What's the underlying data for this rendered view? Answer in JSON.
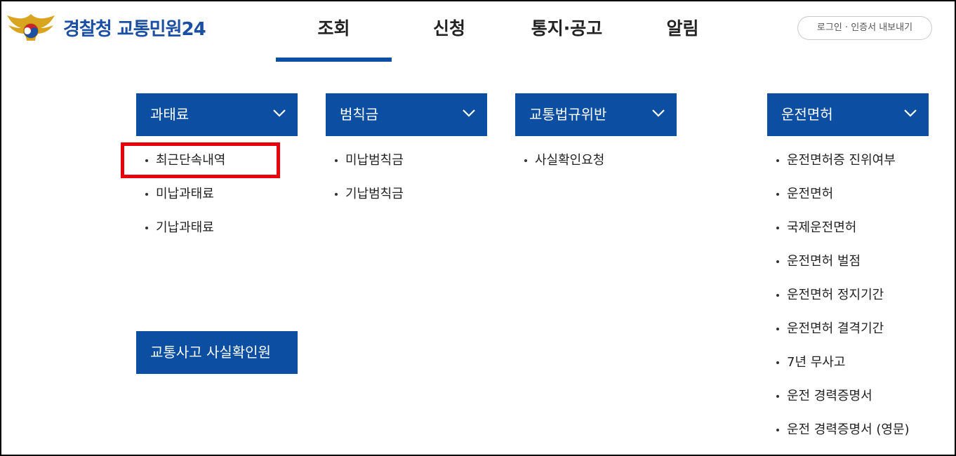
{
  "header": {
    "logo_text": "경찰청 교통민원24",
    "nav": [
      "조회",
      "신청",
      "통지·공고",
      "알림"
    ],
    "login_label": "로그인 · 인증서 내보내기"
  },
  "categories": [
    {
      "title": "과태료",
      "items": [
        "최근단속내역",
        "미납과태료",
        "기납과태료"
      ]
    },
    {
      "title": "범칙금",
      "items": [
        "미납범칙금",
        "기납범칙금"
      ]
    },
    {
      "title": "교통법규위반",
      "items": [
        "사실확인요청"
      ]
    },
    {
      "title": "운전면허",
      "items": [
        "운전면허증 진위여부",
        "운전면허",
        "국제운전면허",
        "운전면허 벌점",
        "운전면허 정지기간",
        "운전면허 결격기간",
        "7년 무사고",
        "운전 경력증명서",
        "운전 경력증명서 (영문)"
      ]
    }
  ],
  "accident_button": "교통사고 사실확인원",
  "colors": {
    "primary": "#0b4ea2",
    "highlight": "#e8000b"
  }
}
